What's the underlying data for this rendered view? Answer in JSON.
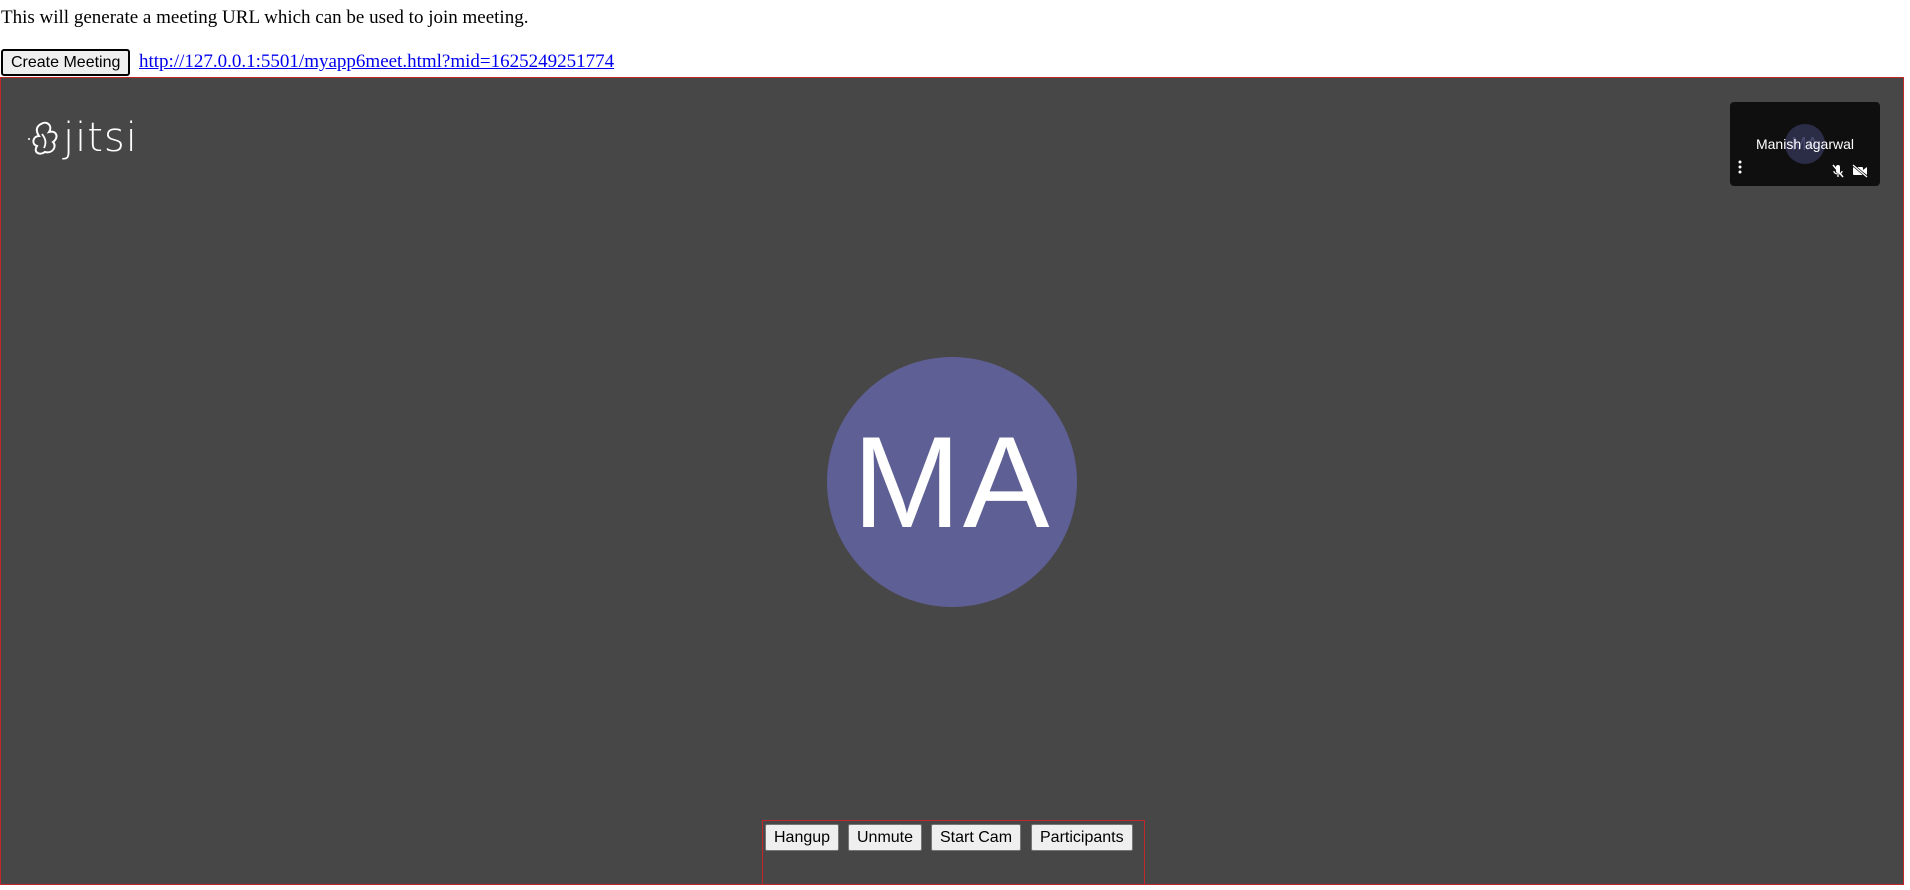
{
  "intro_text": "This will generate a meeting URL which can be used to join meeting.",
  "create_button_label": "Create Meeting",
  "meeting_url": "http://127.0.0.1:5501/myapp6meet.html?mid=1625249251774",
  "jitsi": {
    "logo_text": "jitsi",
    "main_avatar_initials": "MA",
    "avatar_color": "#5e5f94",
    "background_color": "#474747",
    "thumbnail": {
      "avatar_initials": "MA",
      "name": "Manish agarwal",
      "icons": [
        "more-vertical-icon",
        "mic-muted-icon",
        "camera-off-icon"
      ]
    }
  },
  "toolbar": {
    "hangup_label": "Hangup",
    "unmute_label": "Unmute",
    "start_cam_label": "Start Cam",
    "participants_label": "Participants"
  },
  "border_color": "#c0262b"
}
